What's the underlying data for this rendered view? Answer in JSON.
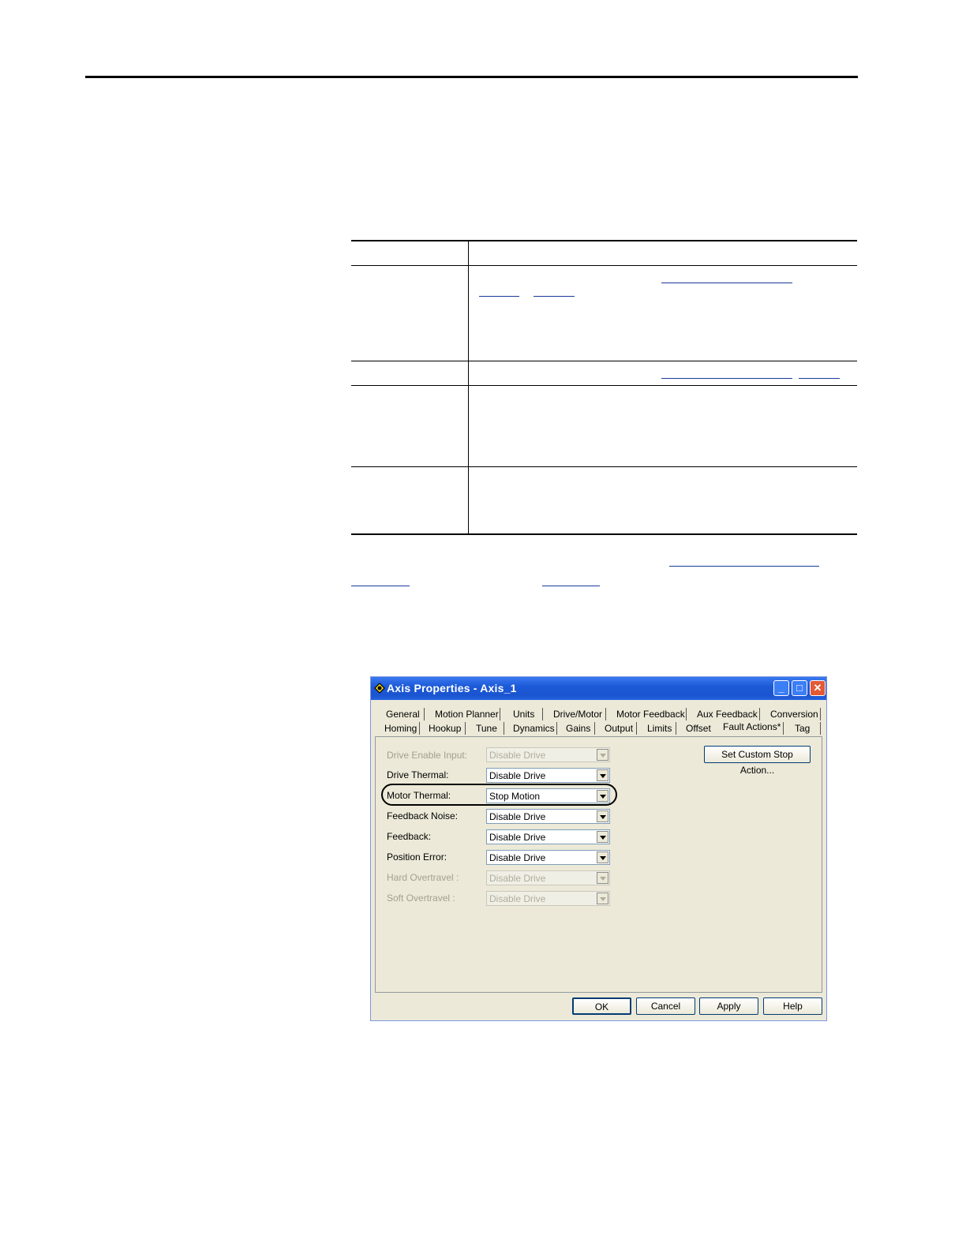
{
  "dialog": {
    "title": "Axis Properties - Axis_1",
    "tabs_row1": [
      "General",
      "Motion Planner",
      "Units",
      "Drive/Motor",
      "Motor Feedback",
      "Aux Feedback",
      "Conversion"
    ],
    "tabs_row2": [
      "Homing",
      "Hookup",
      "Tune",
      "Dynamics",
      "Gains",
      "Output",
      "Limits",
      "Offset",
      "Fault Actions*",
      "Tag"
    ],
    "active_tab": "Fault Actions*",
    "fields": [
      {
        "label": "Drive Enable Input:",
        "value": "Disable Drive",
        "enabled": false
      },
      {
        "label": "Drive Thermal:",
        "value": "Disable Drive",
        "enabled": true
      },
      {
        "label": "Motor Thermal:",
        "value": "Stop Motion",
        "enabled": true,
        "highlighted": true
      },
      {
        "label": "Feedback Noise:",
        "value": "Disable Drive",
        "enabled": true
      },
      {
        "label": "Feedback:",
        "value": "Disable Drive",
        "enabled": true
      },
      {
        "label": "Position Error:",
        "value": "Disable Drive",
        "enabled": true
      },
      {
        "label": "Hard Overtravel :",
        "value": "Disable Drive",
        "enabled": false
      },
      {
        "label": "Soft Overtravel :",
        "value": "Disable Drive",
        "enabled": false
      }
    ],
    "custom_stop_button": "Set Custom Stop Action...",
    "buttons": {
      "ok": "OK",
      "cancel": "Cancel",
      "apply": "Apply",
      "help": "Help"
    }
  }
}
